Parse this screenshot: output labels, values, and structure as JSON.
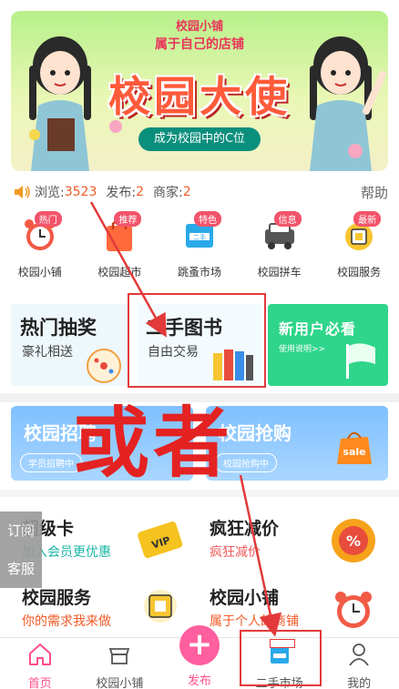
{
  "banner": {
    "brand": "校园小铺",
    "slogan": "属于自己的店铺",
    "title": "校园大使",
    "cta": "成为校园中的C位"
  },
  "stats": {
    "views_label": "浏览:",
    "views": "3523",
    "posts_label": "发布:",
    "posts": "2",
    "merchants_label": "商家:",
    "merchants": "2",
    "help": "帮助"
  },
  "categories": [
    {
      "badge": "热门",
      "label": "校园小铺",
      "icon": "alarm-clock-icon",
      "color": "#f15a45"
    },
    {
      "badge": "推荐",
      "label": "校园超市",
      "icon": "shopping-bag-icon",
      "color": "#ff6a3d"
    },
    {
      "badge": "特色",
      "label": "跳蚤市场",
      "icon": "second-hand-card-icon",
      "color": "#2aa9e9"
    },
    {
      "badge": "信息",
      "label": "校园拼车",
      "icon": "car-icon",
      "color": "#555555"
    },
    {
      "badge": "最新",
      "label": "校园服务",
      "icon": "service-icon",
      "color": "#f7c531"
    }
  ],
  "promos": [
    {
      "title": "热门抽奖",
      "subtitle": "豪礼相送"
    },
    {
      "title": "二手图书",
      "subtitle": "自由交易"
    },
    {
      "title": "新用户必看",
      "subtitle": "使用说明>>"
    }
  ],
  "blue_cards": [
    {
      "title": "校园招聘",
      "pill": "学员招聘中"
    },
    {
      "title": "校园抢购",
      "pill": "校园抢购中",
      "tag": "sale"
    }
  ],
  "features": [
    {
      "title": "超级卡",
      "subtitle": "加入会员更优惠",
      "sub_color": "#19b5a5"
    },
    {
      "title": "疯狂减价",
      "subtitle": "疯狂减价",
      "sub_color": "#f05a5a"
    },
    {
      "title": "校园服务",
      "subtitle": "你的需求我来做",
      "sub_color": "#f05a28"
    },
    {
      "title": "校园小铺",
      "subtitle": "属于个人的商铺",
      "sub_color": "#f05a28"
    }
  ],
  "side_tabs": [
    "订阅",
    "客服"
  ],
  "annotation": {
    "text": "或者"
  },
  "tabbar": [
    {
      "label": "首页",
      "active": true
    },
    {
      "label": "校园小铺",
      "active": false
    },
    {
      "label": "发布",
      "active": false,
      "publish": true
    },
    {
      "label": "二手市场",
      "active": false
    },
    {
      "label": "我的",
      "active": false
    }
  ],
  "colors": {
    "accent": "#ff4f8b",
    "annotation_red": "#e23a3a",
    "stat_number": "#f05a28"
  }
}
